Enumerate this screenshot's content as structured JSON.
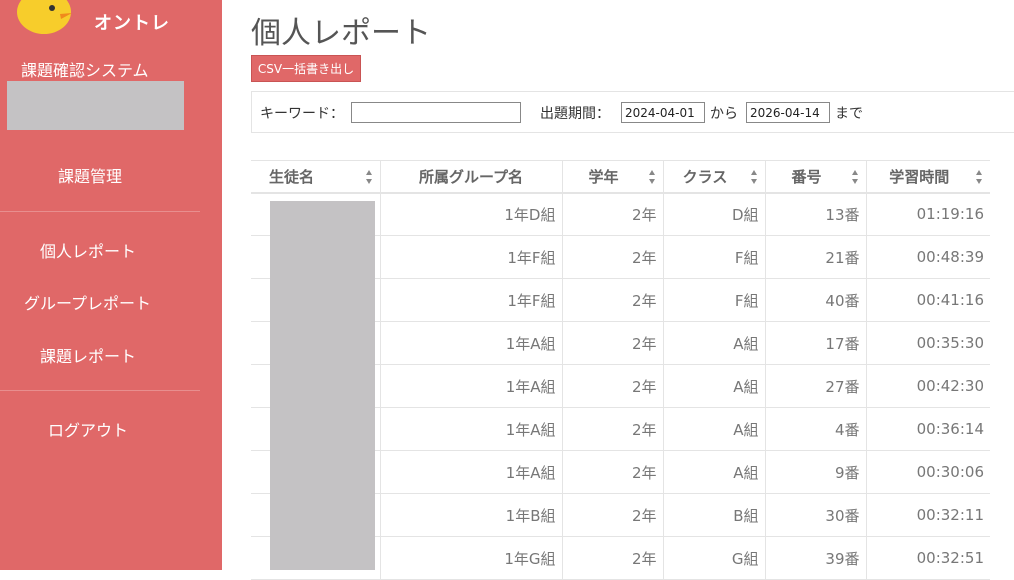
{
  "app": {
    "logo_text": "オントレ",
    "system_name": "課題確認システム"
  },
  "sidebar": {
    "items": [
      {
        "label": "課題管理"
      },
      {
        "label": "個人レポート"
      },
      {
        "label": "グループレポート"
      },
      {
        "label": "課題レポート"
      },
      {
        "label": "ログアウト"
      }
    ]
  },
  "page": {
    "title": "個人レポート",
    "csv_button": "CSV一括書き出し"
  },
  "filters": {
    "keyword_label": "キーワード：",
    "keyword_value": "",
    "period_label": "出題期間：",
    "date_from": "2024-04-01",
    "from_suffix": "から",
    "date_to": "2026-04-14",
    "to_suffix": "まで"
  },
  "table": {
    "headers": [
      "生徒名",
      "所属グループ名",
      "学年",
      "クラス",
      "番号",
      "学習時間"
    ],
    "rows": [
      {
        "group": "1年D組",
        "grade": "2年",
        "class": "D組",
        "number": "13番",
        "time": "01:19:16"
      },
      {
        "group": "1年F組",
        "grade": "2年",
        "class": "F組",
        "number": "21番",
        "time": "00:48:39"
      },
      {
        "group": "1年F組",
        "grade": "2年",
        "class": "F組",
        "number": "40番",
        "time": "00:41:16"
      },
      {
        "group": "1年A組",
        "grade": "2年",
        "class": "A組",
        "number": "17番",
        "time": "00:35:30"
      },
      {
        "group": "1年A組",
        "grade": "2年",
        "class": "A組",
        "number": "27番",
        "time": "00:42:30"
      },
      {
        "group": "1年A組",
        "grade": "2年",
        "class": "A組",
        "number": "4番",
        "time": "00:36:14"
      },
      {
        "group": "1年A組",
        "grade": "2年",
        "class": "A組",
        "number": "9番",
        "time": "00:30:06"
      },
      {
        "group": "1年B組",
        "grade": "2年",
        "class": "B組",
        "number": "30番",
        "time": "00:32:11"
      },
      {
        "group": "1年G組",
        "grade": "2年",
        "class": "G組",
        "number": "39番",
        "time": "00:32:51"
      }
    ]
  },
  "colors": {
    "sidebar_bg": "#e06868",
    "redaction": "#c4c2c4"
  }
}
